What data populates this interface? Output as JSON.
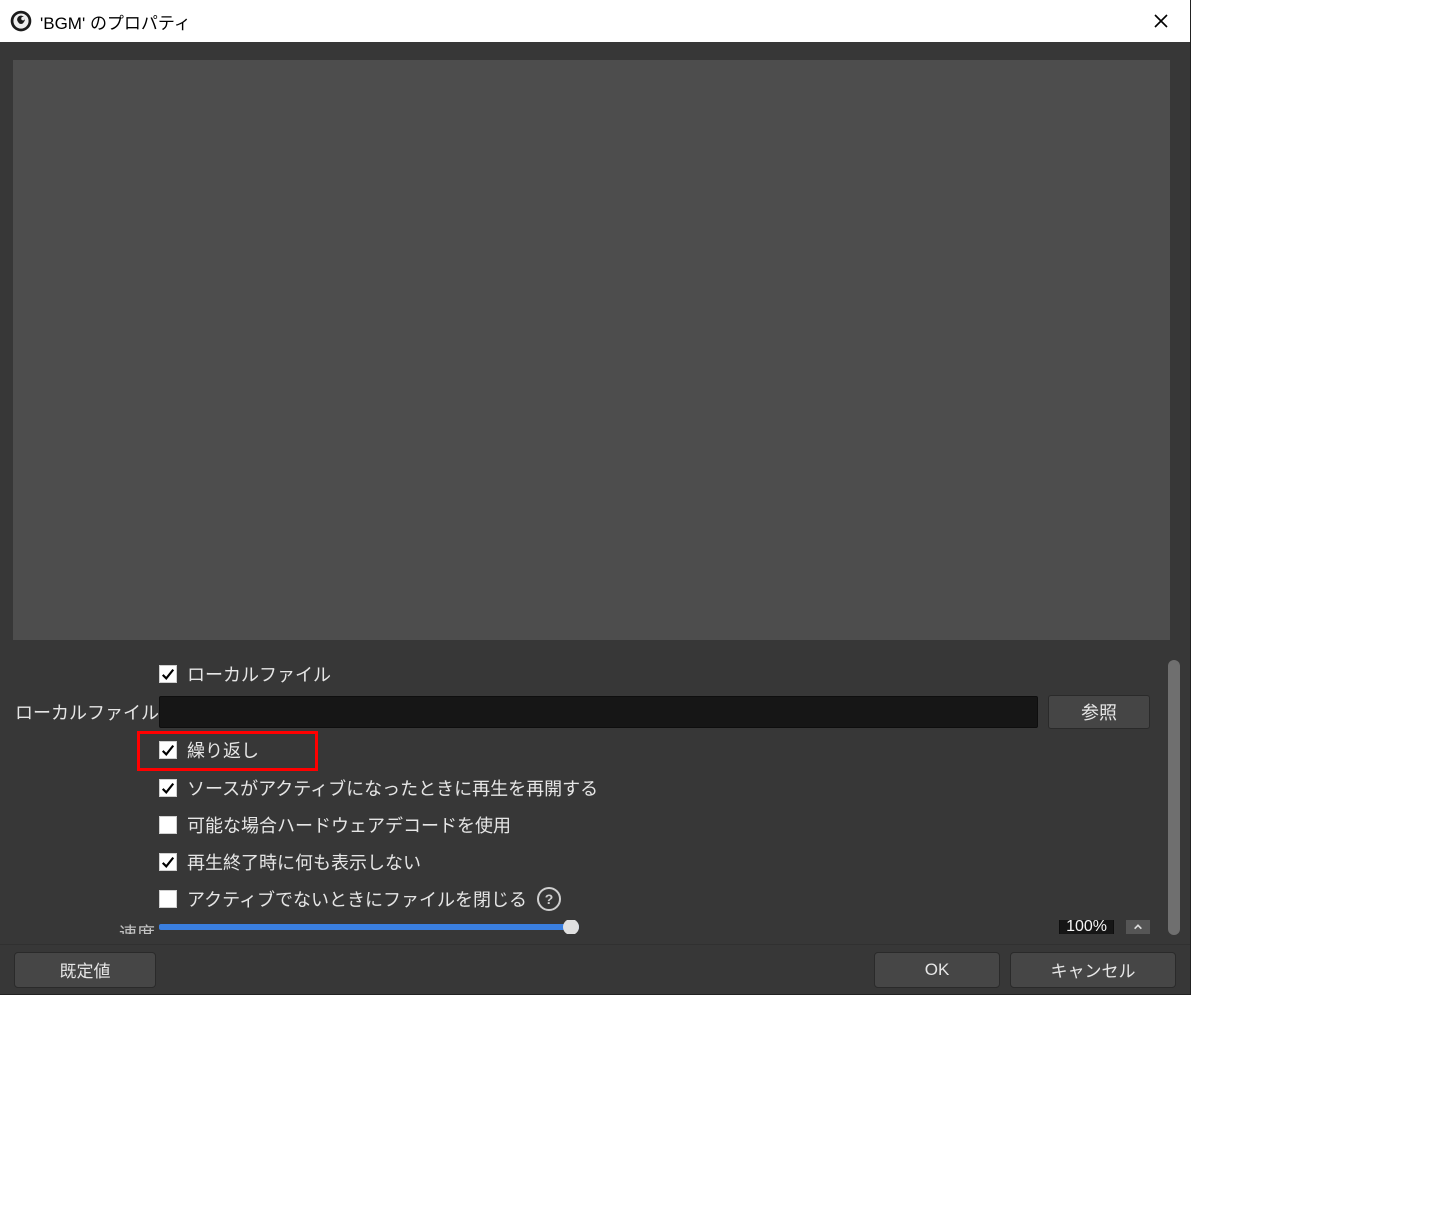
{
  "title": "'BGM' のプロパティ",
  "form": {
    "local_file_checkbox_label": "ローカルファイル",
    "local_file_row_label": "ローカルファイル",
    "local_file_value": "",
    "browse_label": "参照",
    "loop_label": "繰り返し",
    "restart_label": "ソースがアクティブになったときに再生を再開する",
    "hwdecode_label": "可能な場合ハードウェアデコードを使用",
    "show_nothing_label": "再生終了時に何も表示しない",
    "close_inactive_label": "アクティブでないときにファイルを閉じる",
    "speed_label": "速度",
    "speed_value": "100%",
    "checked": {
      "local_file": true,
      "loop": true,
      "restart": true,
      "hwdecode": false,
      "show_nothing": true,
      "close_inactive": false
    }
  },
  "footer": {
    "defaults": "既定値",
    "ok": "OK",
    "cancel": "キャンセル"
  }
}
